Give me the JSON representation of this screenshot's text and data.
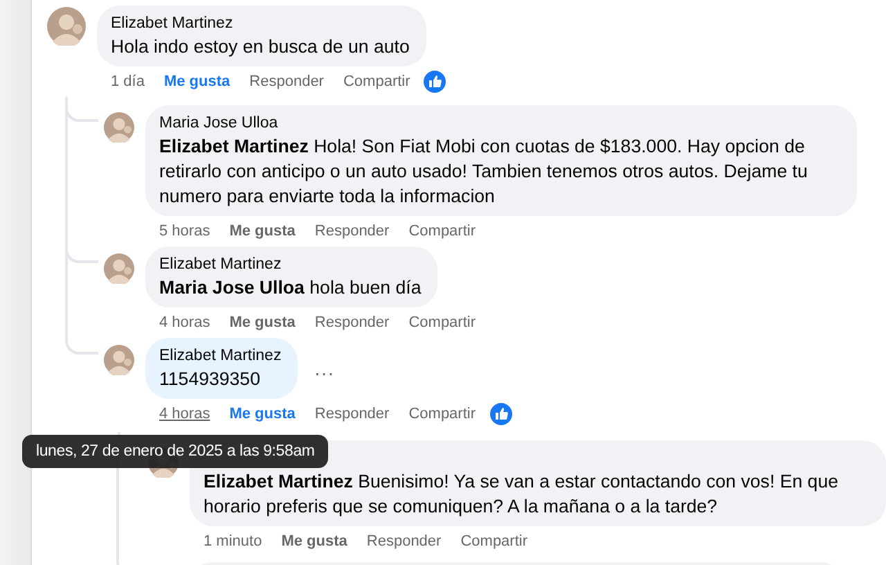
{
  "comments": [
    {
      "kind": "comment",
      "author": "Elizabet Martinez",
      "text": "Hola indo estoy en busca de un auto",
      "time": "1 día",
      "like_label": "Me gusta",
      "reply_label": "Responder",
      "share_label": "Compartir",
      "liked": true,
      "children": [
        {
          "kind": "comment",
          "author": "Maria Jose Ulloa",
          "text": "**Elizabet Martinez** Hola! Son Fiat Mobi con cuotas de $183.000. Hay opcion de retirarlo con anticipo o un auto usado! Tambien tenemos otros autos. Dejame tu numero para enviarte toda la informacion",
          "time": "5 horas",
          "like_label": "Me gusta",
          "reply_label": "Responder",
          "share_label": "Compartir",
          "liked": false
        },
        {
          "kind": "comment",
          "author": "Elizabet Martinez",
          "text": "**Maria Jose Ulloa** hola buen día",
          "time": "4 horas",
          "like_label": "Me gusta",
          "reply_label": "Responder",
          "share_label": "Compartir",
          "liked": false
        },
        {
          "kind": "comment",
          "author": "Elizabet Martinez",
          "text": "1154939350",
          "time": "4 horas",
          "like_label": "Me gusta",
          "reply_label": "Responder",
          "share_label": "Compartir",
          "liked": true,
          "highlighted": true,
          "time_hovered": true,
          "options": "...",
          "children": [
            {
              "kind": "comment",
              "text": "**Elizabet Martinez** Buenisimo! Ya se van a estar contactando con vos! En que horario preferis que se comuniquen? A la mañana o a la tarde?",
              "time": "1 minuto",
              "like_label": "Me gusta",
              "reply_label": "Responder",
              "share_label": "Compartir",
              "liked": false
            },
            {
              "kind": "cut_off"
            }
          ]
        }
      ]
    }
  ],
  "tooltip": "lunes, 27 de enero de 2025 a las 9:58am"
}
